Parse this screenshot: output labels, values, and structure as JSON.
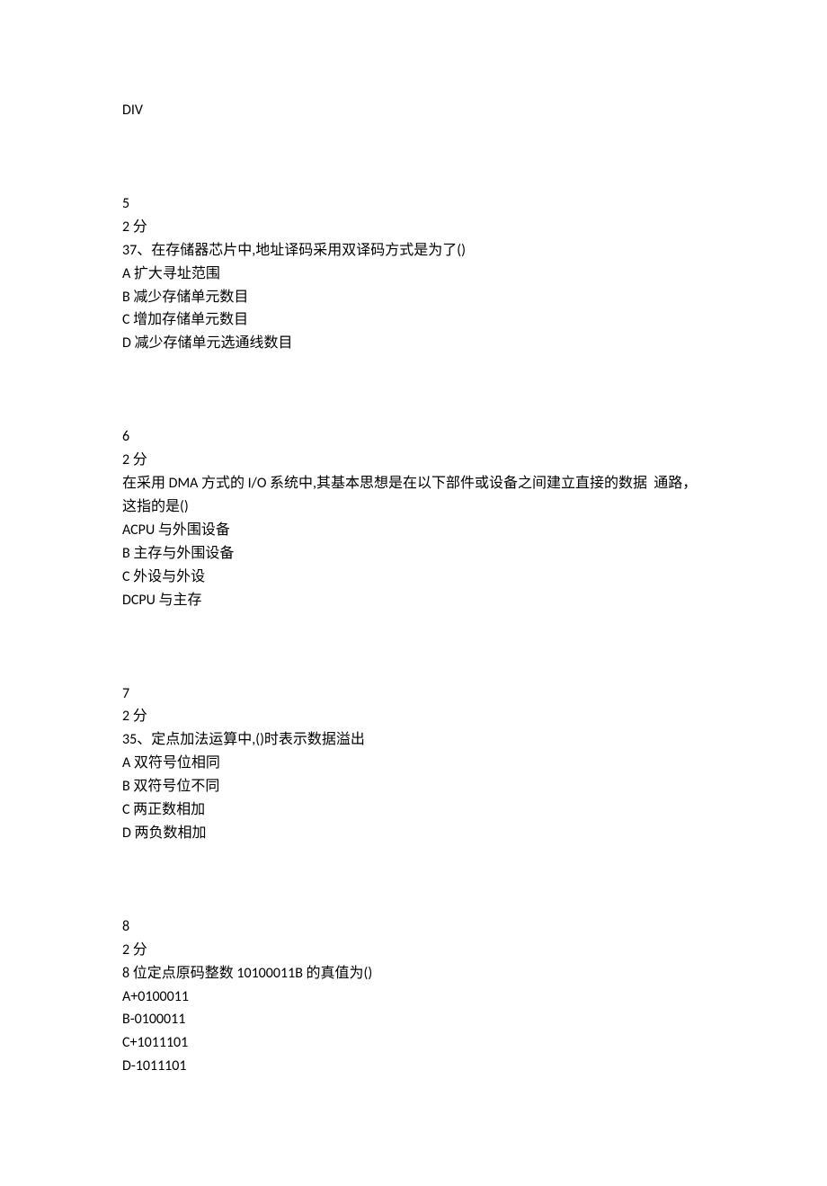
{
  "header": {
    "div": "DIV"
  },
  "q5": {
    "number": "5",
    "points": "2 分",
    "stem": "37、在存储器芯片中,地址译码采用双译码方式是为了()",
    "A": "A 扩大寻址范围",
    "B": "B 减少存储单元数目",
    "C": "C 增加存储单元数目",
    "D": "D 减少存储单元选通线数目"
  },
  "q6": {
    "number": "6",
    "points": "2 分",
    "stem_line1": "在采用 DMA 方式的 I/O 系统中,其基本思想是在以下部件或设备之间建立直接的数据  通路，",
    "stem_line2": "这指的是()",
    "A": "ACPU 与外围设备",
    "B": "B 主存与外围设备",
    "C": "C 外设与外设",
    "D": "DCPU 与主存"
  },
  "q7": {
    "number": "7",
    "points": "2 分",
    "stem": "35、定点加法运算中,()时表示数据溢出",
    "A": "A 双符号位相同",
    "B": "B 双符号位不同",
    "C": "C 两正数相加",
    "D": "D 两负数相加"
  },
  "q8": {
    "number": "8",
    "points": "2 分",
    "stem": "8 位定点原码整数 10100011B 的真值为()",
    "A": "A+0100011",
    "B": "B-0100011",
    "C": "C+1011101",
    "D": "D-1011101"
  }
}
